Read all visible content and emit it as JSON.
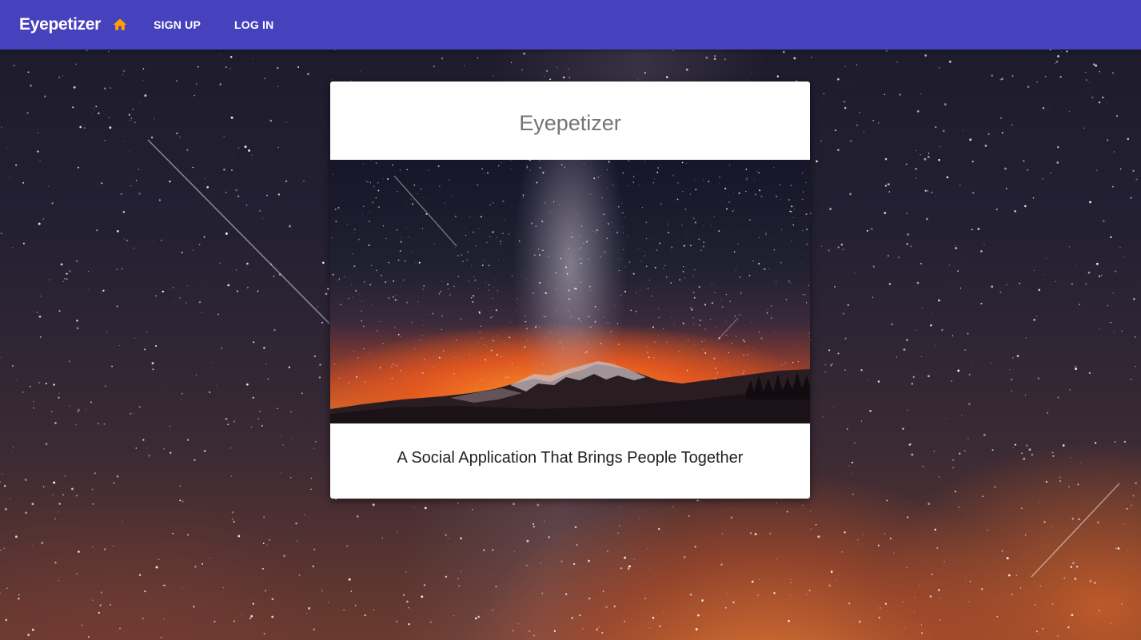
{
  "appbar": {
    "brand": "Eyepetizer",
    "home_icon": "home-icon",
    "sign_up_label": "SIGN UP",
    "log_in_label": "LOG IN",
    "background_color": "#4641bd",
    "accent_color": "#ffa000"
  },
  "card": {
    "title": "Eyepetizer",
    "image": "night-sky-mountain-image",
    "tagline": "A Social Application That Brings People Together"
  },
  "background": {
    "image": "starry-night-sky"
  }
}
